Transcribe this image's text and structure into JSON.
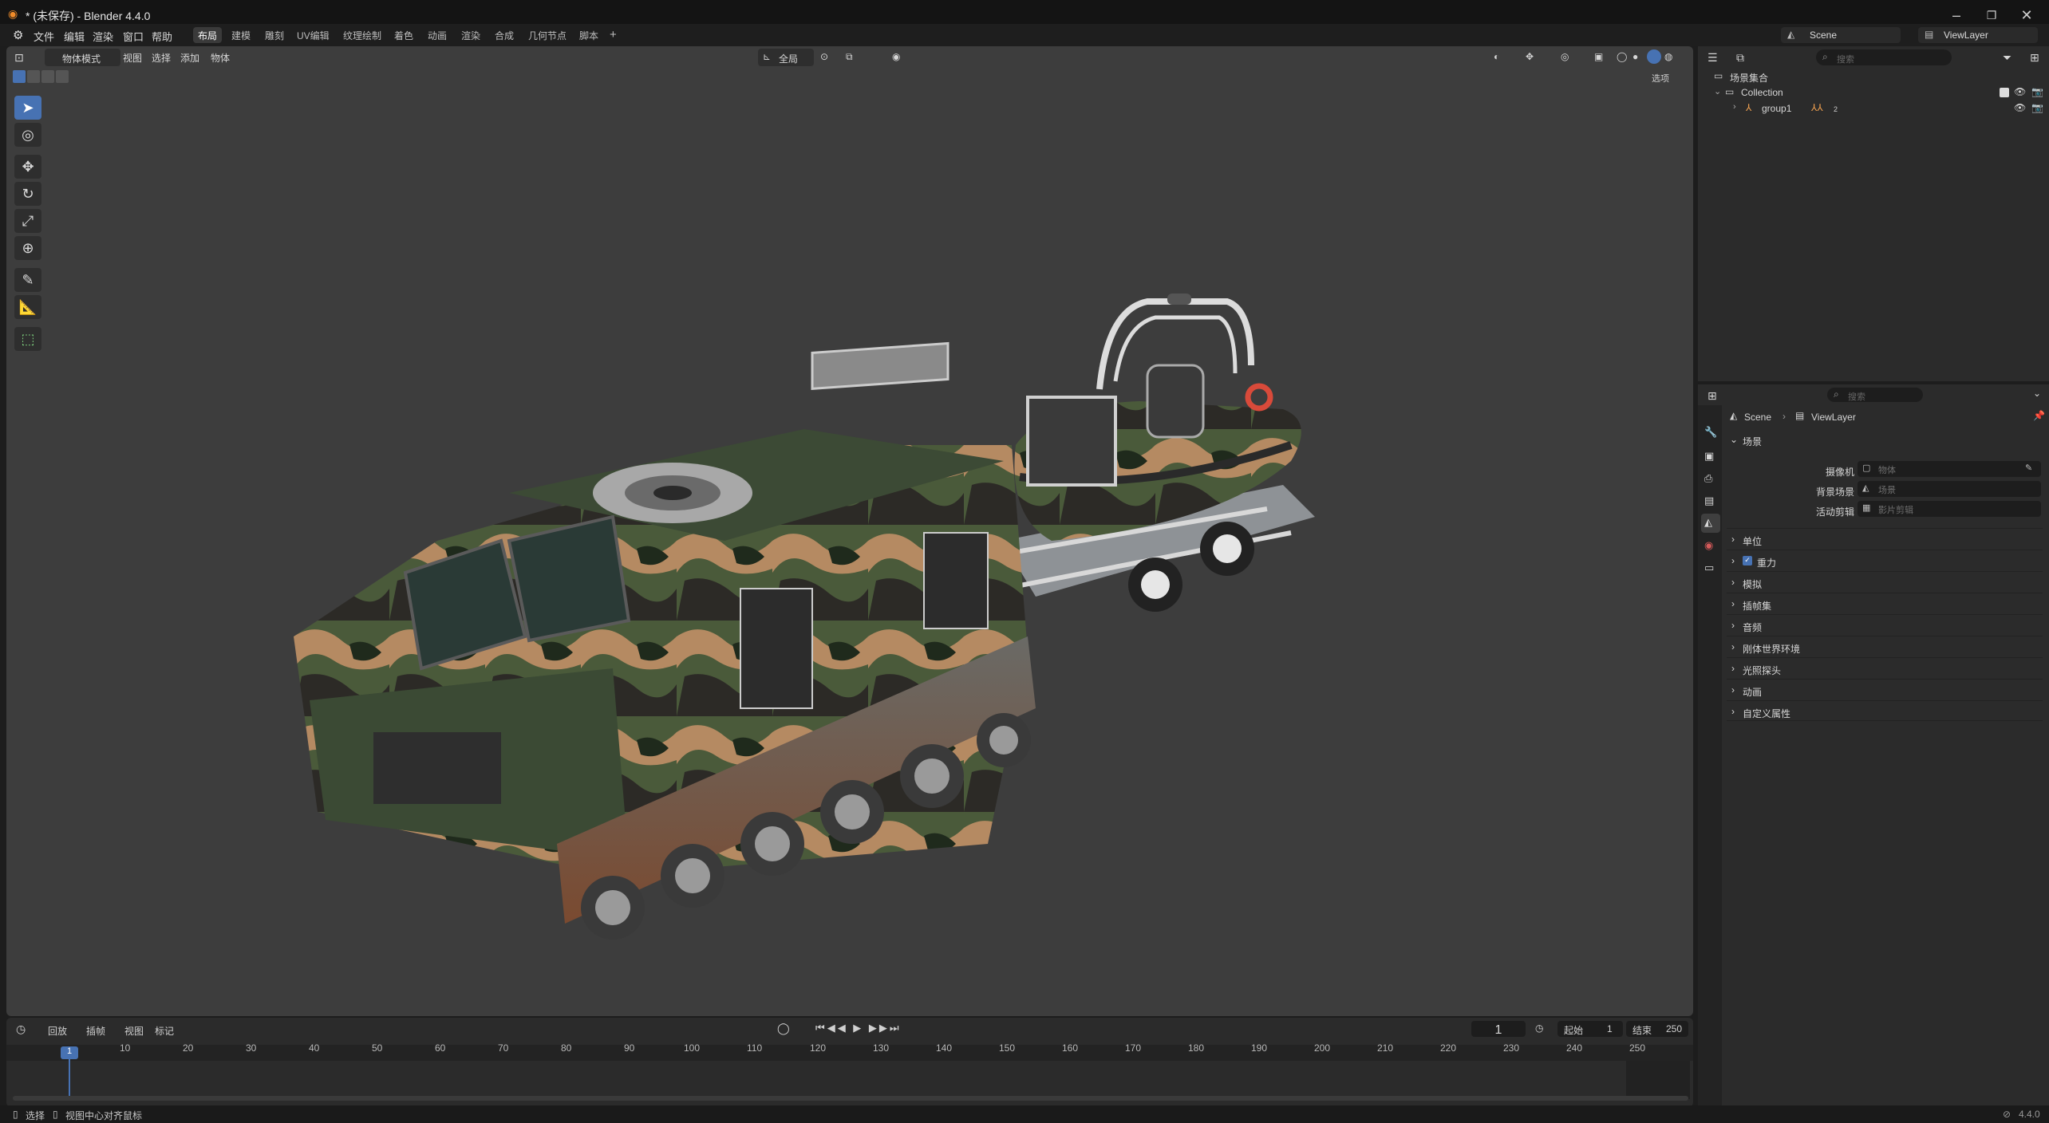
{
  "window": {
    "title": "* (未保存) - Blender 4.4.0"
  },
  "menus": [
    "文件",
    "编辑",
    "渲染",
    "窗口",
    "帮助"
  ],
  "workspaces": [
    "布局",
    "建模",
    "雕刻",
    "UV编辑",
    "纹理绘制",
    "着色",
    "动画",
    "渲染",
    "合成",
    "几何节点",
    "脚本"
  ],
  "active_workspace": "布局",
  "scene_selector": {
    "scene": "Scene",
    "view_layer": "ViewLayer"
  },
  "viewport": {
    "mode": "物体模式",
    "menus": [
      "视图",
      "选择",
      "添加",
      "物体"
    ],
    "transform_orientation": "全局",
    "options_label": "选项"
  },
  "outliner": {
    "search_placeholder": "搜索",
    "root": "场景集合",
    "collection": "Collection",
    "object": "group1",
    "modifier_count": "2"
  },
  "properties": {
    "search_placeholder": "搜索",
    "breadcrumb_scene": "Scene",
    "breadcrumb_viewlayer": "ViewLayer",
    "section_title": "场景",
    "camera_label": "摄像机",
    "camera_placeholder": "物体",
    "background_label": "背景场景",
    "background_placeholder": "场景",
    "clip_label": "活动剪辑",
    "clip_placeholder": "影片剪辑",
    "panels": [
      "单位",
      "重力",
      "模拟",
      "插帧集",
      "音频",
      "刚体世界环境",
      "光照探头",
      "动画",
      "自定义属性"
    ]
  },
  "timeline": {
    "menus": [
      "回放",
      "插帧",
      "视图",
      "标记"
    ],
    "current_frame": "1",
    "start_label": "起始",
    "start_value": "1",
    "end_label": "结束",
    "end_value": "250",
    "ruler": [
      "10",
      "20",
      "30",
      "40",
      "50",
      "60",
      "70",
      "80",
      "90",
      "100",
      "110",
      "120",
      "130",
      "140",
      "150",
      "160",
      "170",
      "180",
      "190",
      "200",
      "210",
      "220",
      "230",
      "240",
      "250"
    ],
    "playhead": "1"
  },
  "statusbar": {
    "left1": "选择",
    "left2": "视图中心对齐鼠标",
    "version": "4.4.0"
  }
}
